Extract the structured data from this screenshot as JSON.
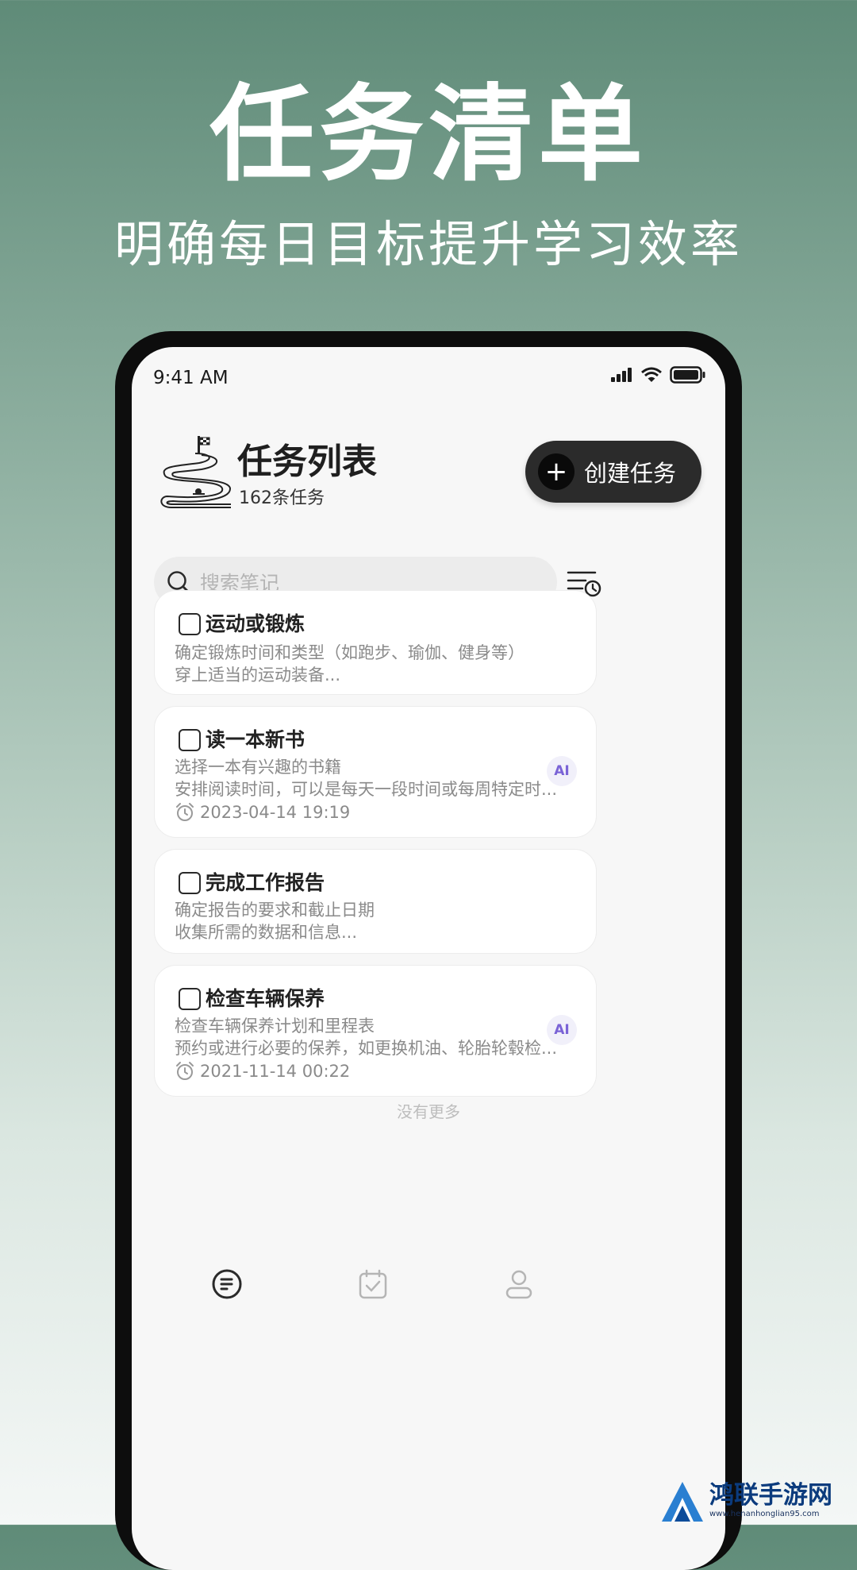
{
  "promo": {
    "title": "任务清单",
    "subtitle": "明确每日目标提升学习效率"
  },
  "status_bar": {
    "time": "9:41 AM"
  },
  "header": {
    "title": "任务列表",
    "count": "162条任务",
    "create_button": "创建任务"
  },
  "search": {
    "placeholder": "搜索笔记"
  },
  "tasks": [
    {
      "title": "运动或锻炼",
      "line1": "确定锻炼时间和类型（如跑步、瑜伽、健身等）",
      "line2": "穿上适当的运动装备..."
    },
    {
      "title": "读一本新书",
      "line1": "选择一本有兴趣的书籍",
      "line2": "安排阅读时间，可以是每天一段时间或每周特定时...",
      "time": "2023-04-14 19:19",
      "badge": "AI"
    },
    {
      "title": "完成工作报告",
      "line1": "确定报告的要求和截止日期",
      "line2": "收集所需的数据和信息..."
    },
    {
      "title": "检查车辆保养",
      "line1": "检查车辆保养计划和里程表",
      "line2": "预约或进行必要的保养，如更换机油、轮胎轮毂检...",
      "time": "2021-11-14 00:22",
      "badge": "AI"
    }
  ],
  "list_footer": "没有更多",
  "watermark": {
    "name": "鸿联手游网",
    "url": "www.henanhonglian95.com"
  },
  "colors": {
    "accent_dark": "#2b2b2b",
    "ai_badge": "#7a63d6"
  }
}
